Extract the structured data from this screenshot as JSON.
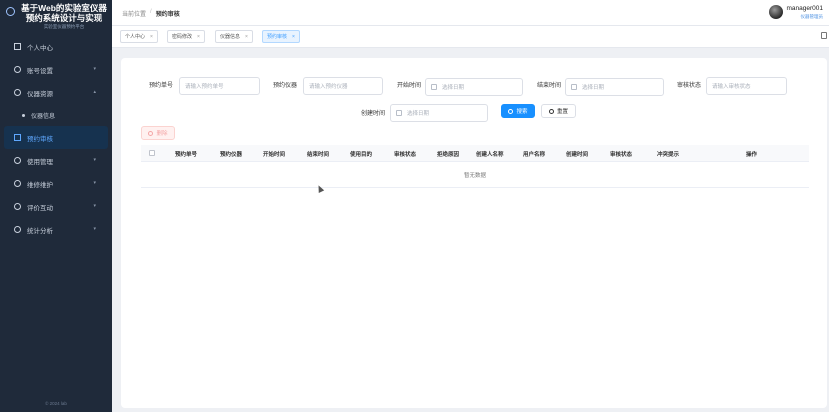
{
  "sidebar": {
    "title": "基于Web的实验室仪器预约系统设计与实现",
    "subtitle": "实验室仪器预约平台",
    "items": [
      {
        "label": "个人中心",
        "icon": "user-square-icon",
        "has_children": false
      },
      {
        "label": "账号设置",
        "icon": "circle-icon",
        "has_children": true
      },
      {
        "label": "仪器资源",
        "icon": "circle-icon",
        "has_children": true
      },
      {
        "label": "仪器信息",
        "icon": "dot-icon",
        "has_children": false,
        "sub": true
      },
      {
        "label": "预约审核",
        "icon": "square-icon",
        "has_children": false,
        "active": true
      },
      {
        "label": "使用管理",
        "icon": "circle-icon",
        "has_children": true
      },
      {
        "label": "维修维护",
        "icon": "circle-icon",
        "has_children": true
      },
      {
        "label": "评价互动",
        "icon": "circle-icon",
        "has_children": true
      },
      {
        "label": "统计分析",
        "icon": "circle-icon",
        "has_children": true
      }
    ],
    "footer": "© 2024 lab"
  },
  "header": {
    "breadcrumb": [
      "当前位置",
      "预约审核"
    ],
    "user_name": "manager001",
    "user_role": "仪器管理员"
  },
  "tags": [
    {
      "label": "个人中心",
      "active": false
    },
    {
      "label": "密码修改",
      "active": false
    },
    {
      "label": "仪器信息",
      "active": false
    },
    {
      "label": "预约审核",
      "active": true
    }
  ],
  "filters": {
    "reservation_no": {
      "label": "预约单号",
      "placeholder": "请输入预约单号"
    },
    "instrument": {
      "label": "预约仪器",
      "placeholder": "请输入预约仪器"
    },
    "start_time": {
      "label": "开始时间",
      "placeholder": "选择日期"
    },
    "end_time": {
      "label": "结束时间",
      "placeholder": "选择日期"
    },
    "audit_status": {
      "label": "审核状态",
      "placeholder": "请输入审核状态"
    },
    "created_time": {
      "label": "创建时间",
      "placeholder": "选择日期"
    },
    "search_button": "搜索",
    "reset_button": "重置"
  },
  "actions": {
    "delete_button": "删除"
  },
  "table": {
    "columns": [
      "预约单号",
      "预约仪器",
      "开始时间",
      "结束时间",
      "使用目的",
      "审核状态",
      "拒绝原因",
      "创建人名称",
      "用户名称",
      "创建时间",
      "审核状态",
      "冲突提示",
      "操作"
    ],
    "empty_text": "暂无数据"
  },
  "colors": {
    "sidebar_bg": "#1f2a3a",
    "accent": "#1890ff",
    "active_menu_text": "#5fa8ff"
  }
}
